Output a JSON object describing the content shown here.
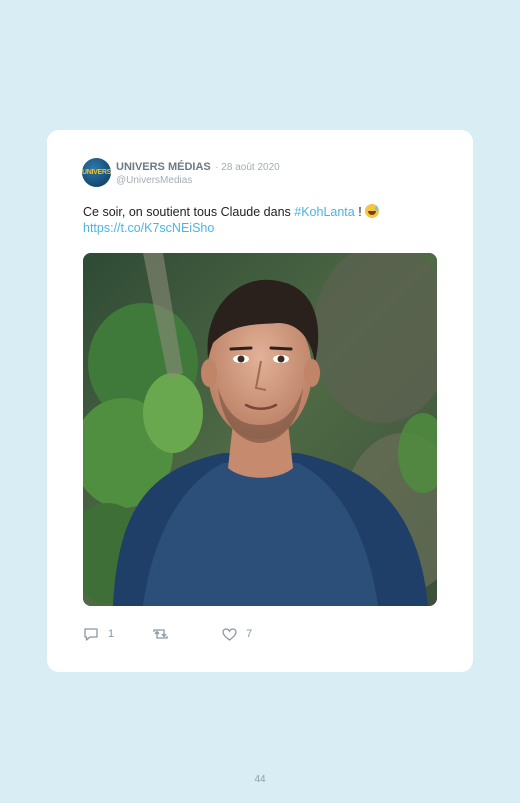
{
  "tweet": {
    "account_name": "UNIVERS MÉDIAS",
    "date": "· 28 août 2020",
    "handle": "@UniversMedias",
    "avatar_text": "UNIVERS",
    "text_before": "Ce soir, on soutient tous Claude dans ",
    "hashtag": "#KohLanta",
    "text_after": " ! ",
    "emoji": "grinning-sweat-emoji",
    "link": "https://t.co/K7scNEiSho",
    "photo": "photo-man-blue-tshirt-jungle",
    "replies": "1",
    "retweets": "",
    "likes": "7"
  },
  "page_number": "44",
  "colors": {
    "background": "#d9eef4",
    "card": "#ffffff",
    "link": "#4ab4e6"
  }
}
